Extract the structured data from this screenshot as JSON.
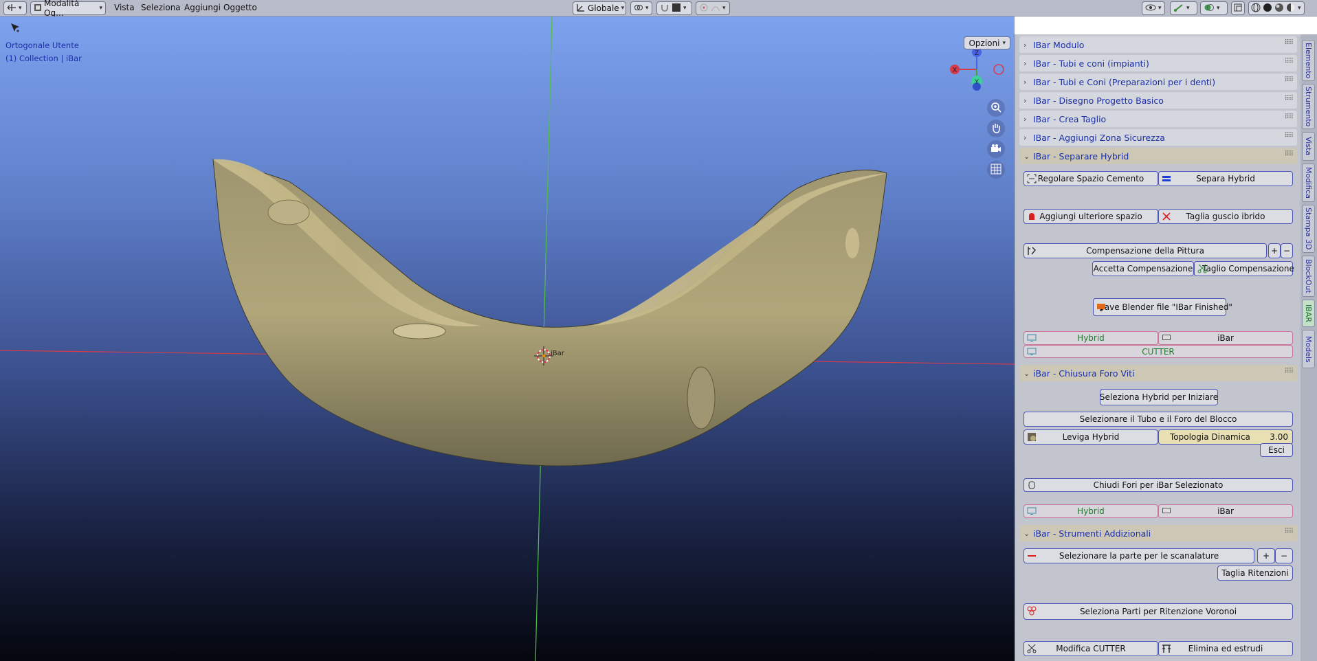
{
  "header": {
    "mode_label": "Modalità Og...",
    "menus": [
      "Vista",
      "Seleziona",
      "Aggiungi",
      "Oggetto"
    ],
    "orientation_label": "Globale",
    "icons": [
      "editor-type-icon",
      "object-mode-icon",
      "transform-orientation-icon",
      "pivot-icon",
      "snap-icon",
      "proportional-edit-icon",
      "visibility-icon",
      "gizmo-icon",
      "overlay-icon",
      "xray-icon",
      "shading-solid-icon",
      "shading-material-icon",
      "shading-rendered-icon"
    ]
  },
  "viewport": {
    "view_name": "Ortogonale Utente",
    "collection_label": "(1) Collection | iBar",
    "origin_label": "iBar",
    "options_label": "Opzioni",
    "axis_x_label": "X",
    "axis_y_label": "Y",
    "axis_z_label": "Z",
    "colors": {
      "x_axis": "#d83a4a",
      "y_axis": "#3fa83a",
      "model": "#b7ab80",
      "sky_top": "#7ea2ee",
      "ground_bottom": "#05070e"
    }
  },
  "tabs": [
    "Elemento",
    "Strumento",
    "Vista",
    "Modifica",
    "Stampa 3D",
    "BlockOut",
    "IBAR",
    "Models"
  ],
  "active_tab": "IBAR",
  "panels": {
    "collapsed": [
      "IBar Modulo",
      "IBar - Tubi e coni (impianti)",
      "IBar - Tubi e Coni (Preparazioni per i denti)",
      "IBar - Disegno Progetto Basico",
      "IBar - Crea Taglio",
      "IBar - Aggiungi Zona Sicurezza"
    ],
    "separare": {
      "title": "IBar - Separare Hybrid",
      "regolare": "Regolare Spazio Cemento",
      "separa": "Separa Hybrid",
      "aggiungi": "Aggiungi ulteriore spazio",
      "taglia_guscio": "Taglia guscio ibrido",
      "compensazione": "Compensazione della Pittura",
      "plus": "+",
      "minus": "−",
      "accetta": "Accetta Compensazione",
      "taglio_comp": "Taglio Compensazione",
      "save": "Save Blender file \"IBar Finished\"",
      "hybrid": "Hybrid",
      "ibar": "iBar",
      "cutter": "CUTTER"
    },
    "chiusura": {
      "title": "iBar - Chiusura Foro  Viti",
      "seleziona_hybrid": "Seleziona Hybrid per Iniziare",
      "selezionare_tubo": "Selezionare il Tubo e il Foro del Blocco",
      "leviga": "Leviga Hybrid",
      "topologia": "Topologia Dinamica",
      "topologia_value": "3.00",
      "esci": "Esci",
      "chiudi": "Chiudi Fori per iBar Selezionato",
      "hybrid": "Hybrid",
      "ibar": "iBar"
    },
    "strumenti": {
      "title": "iBar - Strumenti Addizionali",
      "selezionare_parte": "Selezionare la parte per le scanalature",
      "plus": "+",
      "minus": "−",
      "taglia_ritenzioni": "Taglia Ritenzioni",
      "voronoi": "Seleziona Parti per Ritenzione Voronoi",
      "modifica_cutter": "Modifica CUTTER",
      "elimina": "Elimina ed estrudi"
    }
  }
}
